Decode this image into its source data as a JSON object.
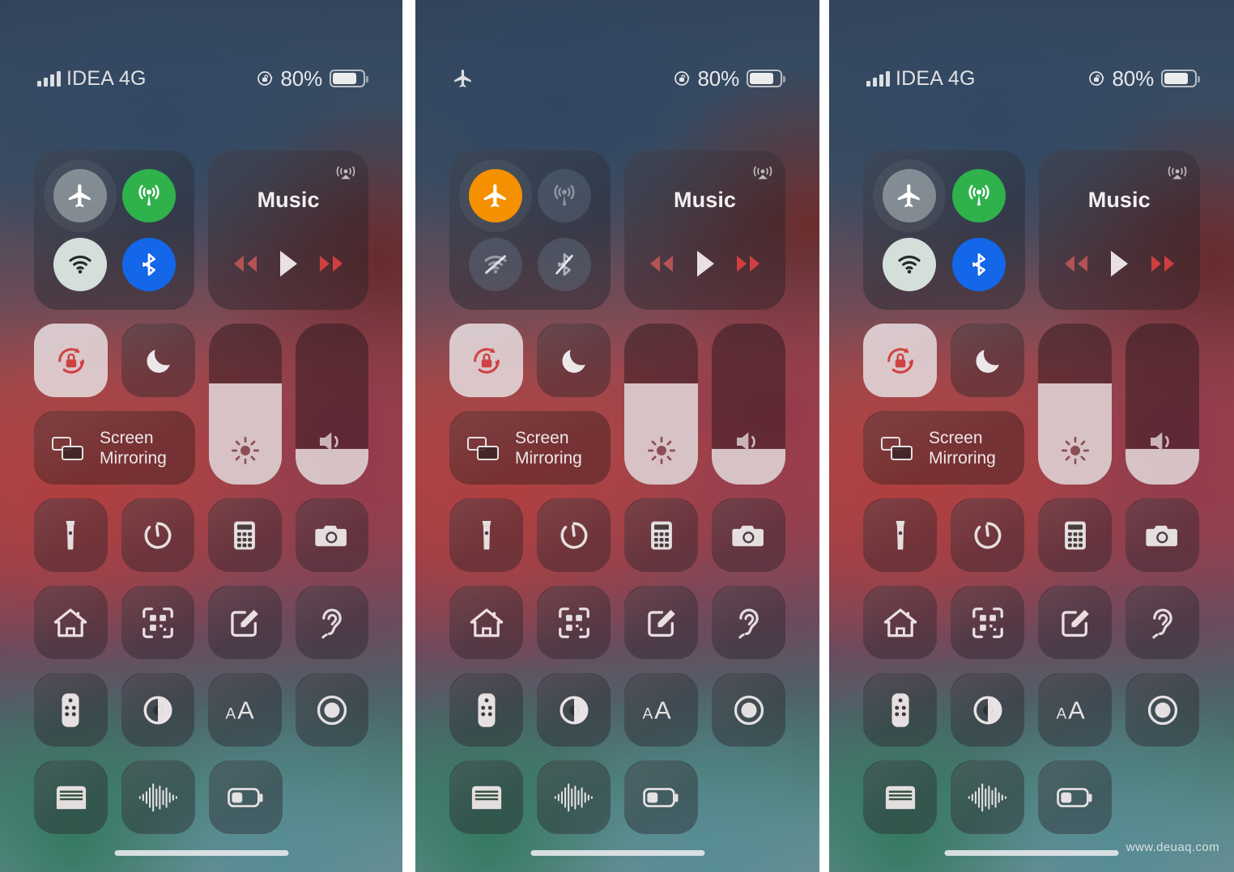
{
  "meta": {
    "watermark": "www.deuaq.com"
  },
  "panels": [
    {
      "id": "panel-airplane-off-1",
      "status_bar": {
        "carrier": "IDEA 4G",
        "signal_bars": 4,
        "show_signal": true,
        "show_airplane": false,
        "battery_percent": "80%",
        "battery_level": 80,
        "rotation_lock_icon": "rotation-lock-icon"
      },
      "connectivity": {
        "airplane": {
          "label": "Airplane Mode",
          "state": "off"
        },
        "cellular": {
          "label": "Cellular Data",
          "state": "on"
        },
        "wifi": {
          "label": "Wi-Fi",
          "state": "on"
        },
        "bluetooth": {
          "label": "Bluetooth",
          "state": "on"
        }
      },
      "music": {
        "title": "Music",
        "airplay_label": "AirPlay",
        "rewind_label": "Rewind",
        "play_label": "Play",
        "forward_label": "Fast Forward"
      },
      "toggles": {
        "rotation_lock": {
          "label": "Rotation Lock",
          "state": "on"
        },
        "do_not_disturb": {
          "label": "Do Not Disturb",
          "state": "off"
        },
        "screen_mirroring": {
          "label_line1": "Screen",
          "label_line2": "Mirroring"
        }
      },
      "sliders": {
        "brightness": {
          "label": "Brightness",
          "value": 63
        },
        "volume": {
          "label": "Volume",
          "value": 22
        }
      }
    },
    {
      "id": "panel-airplane-on",
      "status_bar": {
        "carrier": "",
        "signal_bars": 0,
        "show_signal": false,
        "show_airplane": true,
        "battery_percent": "80%",
        "battery_level": 80,
        "rotation_lock_icon": "rotation-lock-icon"
      },
      "connectivity": {
        "airplane": {
          "label": "Airplane Mode",
          "state": "on"
        },
        "cellular": {
          "label": "Cellular Data",
          "state": "disabled"
        },
        "wifi": {
          "label": "Wi-Fi",
          "state": "disabled"
        },
        "bluetooth": {
          "label": "Bluetooth",
          "state": "disabled"
        }
      },
      "music": {
        "title": "Music",
        "airplay_label": "AirPlay",
        "rewind_label": "Rewind",
        "play_label": "Play",
        "forward_label": "Fast Forward"
      },
      "toggles": {
        "rotation_lock": {
          "label": "Rotation Lock",
          "state": "on"
        },
        "do_not_disturb": {
          "label": "Do Not Disturb",
          "state": "off"
        },
        "screen_mirroring": {
          "label_line1": "Screen",
          "label_line2": "Mirroring"
        }
      },
      "sliders": {
        "brightness": {
          "label": "Brightness",
          "value": 63
        },
        "volume": {
          "label": "Volume",
          "value": 22
        }
      }
    },
    {
      "id": "panel-airplane-off-2",
      "status_bar": {
        "carrier": "IDEA 4G",
        "signal_bars": 4,
        "show_signal": true,
        "show_airplane": false,
        "battery_percent": "80%",
        "battery_level": 80,
        "rotation_lock_icon": "rotation-lock-icon"
      },
      "connectivity": {
        "airplane": {
          "label": "Airplane Mode",
          "state": "off"
        },
        "cellular": {
          "label": "Cellular Data",
          "state": "on"
        },
        "wifi": {
          "label": "Wi-Fi",
          "state": "on"
        },
        "bluetooth": {
          "label": "Bluetooth",
          "state": "on"
        }
      },
      "music": {
        "title": "Music",
        "airplay_label": "AirPlay",
        "rewind_label": "Rewind",
        "play_label": "Play",
        "forward_label": "Fast Forward"
      },
      "toggles": {
        "rotation_lock": {
          "label": "Rotation Lock",
          "state": "on"
        },
        "do_not_disturb": {
          "label": "Do Not Disturb",
          "state": "off"
        },
        "screen_mirroring": {
          "label_line1": "Screen",
          "label_line2": "Mirroring"
        }
      },
      "sliders": {
        "brightness": {
          "label": "Brightness",
          "value": 63
        },
        "volume": {
          "label": "Volume",
          "value": 22
        }
      }
    }
  ],
  "app_shortcuts": [
    {
      "name": "flashlight",
      "label": "Flashlight"
    },
    {
      "name": "timer",
      "label": "Timer"
    },
    {
      "name": "calculator",
      "label": "Calculator"
    },
    {
      "name": "camera",
      "label": "Camera"
    },
    {
      "name": "home",
      "label": "Home"
    },
    {
      "name": "qr-scanner",
      "label": "Scan QR Code"
    },
    {
      "name": "notes",
      "label": "Notes"
    },
    {
      "name": "hearing",
      "label": "Hearing"
    },
    {
      "name": "apple-tv-remote",
      "label": "Apple TV Remote"
    },
    {
      "name": "dark-mode",
      "label": "Dark Mode"
    },
    {
      "name": "text-size",
      "label": "Text Size"
    },
    {
      "name": "screen-recording",
      "label": "Screen Recording"
    },
    {
      "name": "wallet",
      "label": "Wallet"
    },
    {
      "name": "voice-memos",
      "label": "Voice Memos"
    },
    {
      "name": "low-power-mode",
      "label": "Low Power Mode"
    }
  ],
  "colors": {
    "accent_green": "#2fb14c",
    "accent_blue": "#1367e8",
    "accent_orange": "#f59000",
    "toggle_off": "#bec8c8",
    "wifi_on": "#d5dfd9",
    "rotation_lock_red": "#d0403f"
  }
}
